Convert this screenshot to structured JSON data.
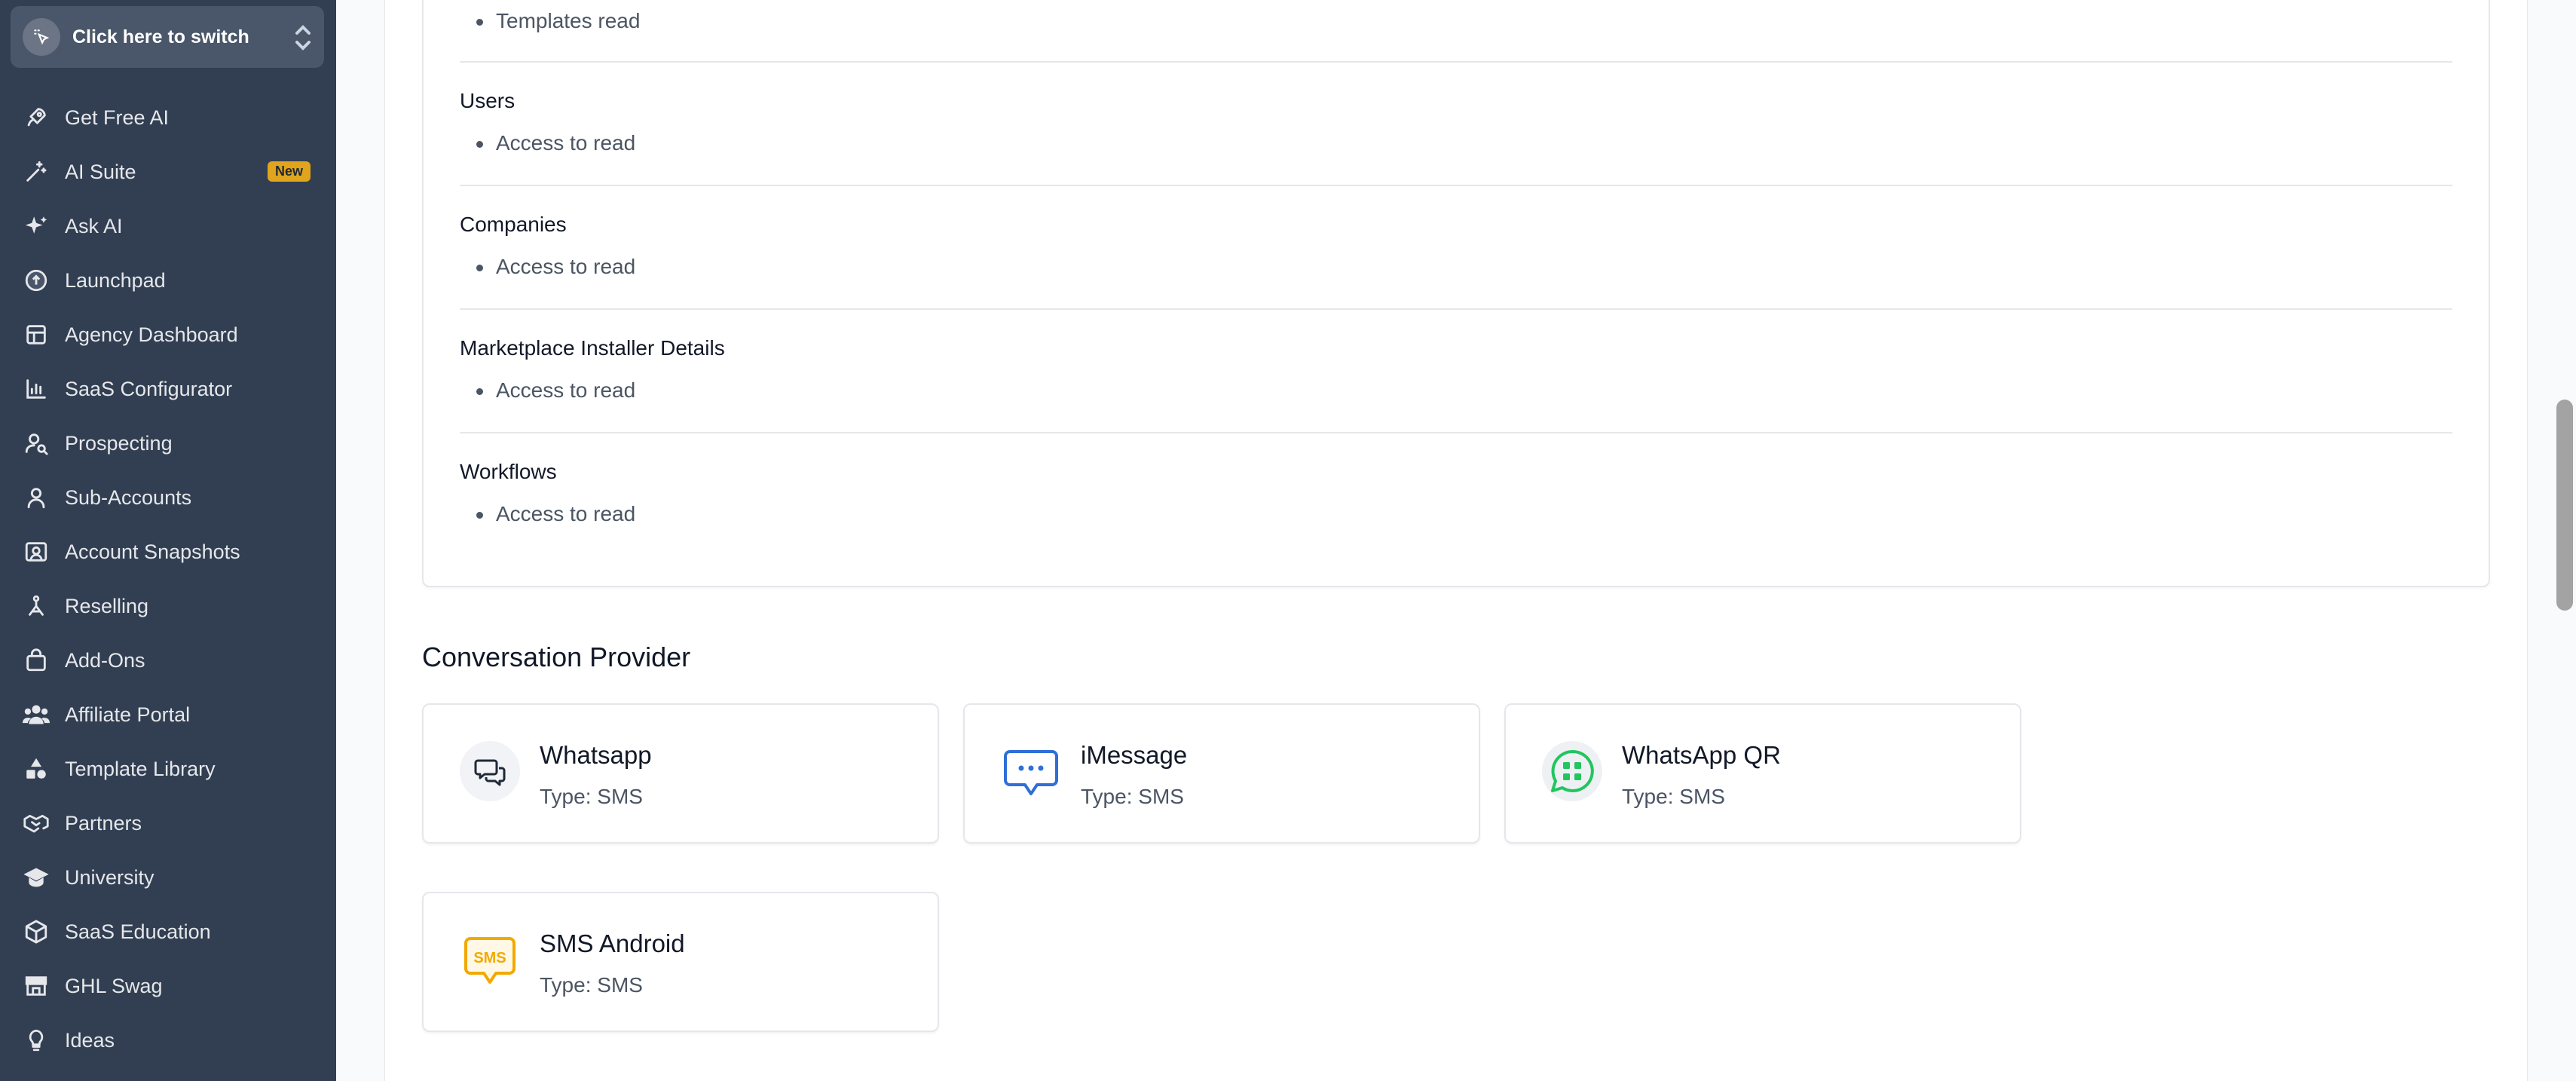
{
  "switcher": {
    "label": "Click here to switch"
  },
  "sidebar": {
    "items": [
      {
        "label": "Get Free AI",
        "icon": "rocket-icon"
      },
      {
        "label": "AI Suite",
        "icon": "magic-wand-icon",
        "badge": "New"
      },
      {
        "label": "Ask AI",
        "icon": "sparkles-icon"
      },
      {
        "label": "Launchpad",
        "icon": "launchpad-icon"
      },
      {
        "label": "Agency Dashboard",
        "icon": "dashboard-icon"
      },
      {
        "label": "SaaS Configurator",
        "icon": "bar-chart-icon"
      },
      {
        "label": "Prospecting",
        "icon": "user-search-icon"
      },
      {
        "label": "Sub-Accounts",
        "icon": "user-icon"
      },
      {
        "label": "Account Snapshots",
        "icon": "snapshot-icon"
      },
      {
        "label": "Reselling",
        "icon": "reselling-icon"
      },
      {
        "label": "Add-Ons",
        "icon": "shopping-bag-icon"
      },
      {
        "label": "Affiliate Portal",
        "icon": "users-icon"
      },
      {
        "label": "Template Library",
        "icon": "shapes-icon"
      },
      {
        "label": "Partners",
        "icon": "handshake-icon"
      },
      {
        "label": "University",
        "icon": "graduation-cap-icon"
      },
      {
        "label": "SaaS Education",
        "icon": "box-icon"
      },
      {
        "label": "GHL Swag",
        "icon": "store-icon"
      },
      {
        "label": "Ideas",
        "icon": "lightbulb-icon"
      }
    ]
  },
  "scopes": {
    "top_item": "Templates read",
    "groups": [
      {
        "title": "Users",
        "item": "Access to read"
      },
      {
        "title": "Companies",
        "item": "Access to read"
      },
      {
        "title": "Marketplace Installer Details",
        "item": "Access to read"
      },
      {
        "title": "Workflows",
        "item": "Access to read"
      }
    ]
  },
  "conversation_provider": {
    "title": "Conversation Provider",
    "providers": [
      {
        "name": "Whatsapp",
        "type": "Type: SMS",
        "icon": "chat-bubbles-icon"
      },
      {
        "name": "iMessage",
        "type": "Type: SMS",
        "icon": "imessage-icon"
      },
      {
        "name": "WhatsApp QR",
        "type": "Type: SMS",
        "icon": "whatsapp-qr-icon"
      },
      {
        "name": "SMS Android",
        "type": "Type: SMS",
        "icon": "sms-icon"
      }
    ]
  },
  "colors": {
    "sidebar_bg": "#323f52",
    "badge": "#e0a51c",
    "imessage_blue": "#2f6fd6",
    "whatsapp_green": "#22c55e",
    "sms_yellow": "#f2a900"
  }
}
